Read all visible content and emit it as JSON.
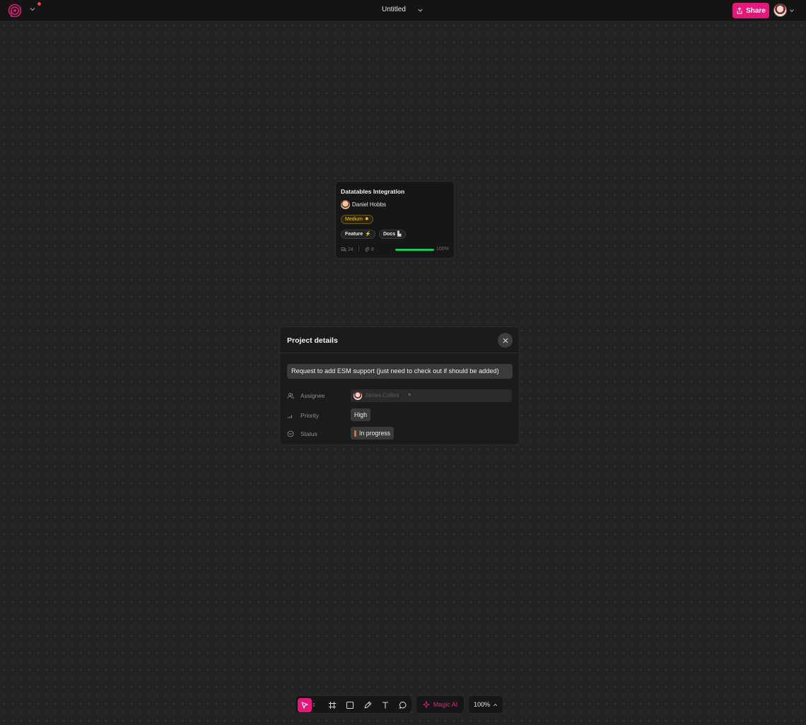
{
  "header": {
    "title": "Untitled",
    "share_label": "Share",
    "accent_color": "#e4187a"
  },
  "task_card": {
    "title": "Datatables Integration",
    "owner": "Daniel Hobbs",
    "priority_tag": "Medium",
    "priority_glyph": "✹",
    "tags": [
      {
        "label": "Feature",
        "glyph": "⚡"
      },
      {
        "label": "Docs",
        "glyph": "▙"
      }
    ],
    "comments": "24",
    "attachments": "8",
    "progress": 1.0,
    "progress_label": "100%",
    "progress_color": "#1fc25a"
  },
  "project_details": {
    "title": "Project details",
    "description": "Request to add ESM support (just need to check out if should be added)",
    "fields": {
      "assignee_label": "Assignee",
      "assignee_value": "James Collins",
      "assignee_remove": "×",
      "priority_label": "Priority",
      "priority_value": "High",
      "status_label": "Status",
      "status_value": "In progress",
      "status_color": "#f0641e"
    }
  },
  "toolbar": {
    "magic_label": "Magic AI",
    "zoom_label": "100%",
    "tools": [
      "pointer-icon",
      "more-icon",
      "frame-icon",
      "rectangle-icon",
      "pen-icon",
      "text-icon",
      "comment-icon"
    ]
  }
}
